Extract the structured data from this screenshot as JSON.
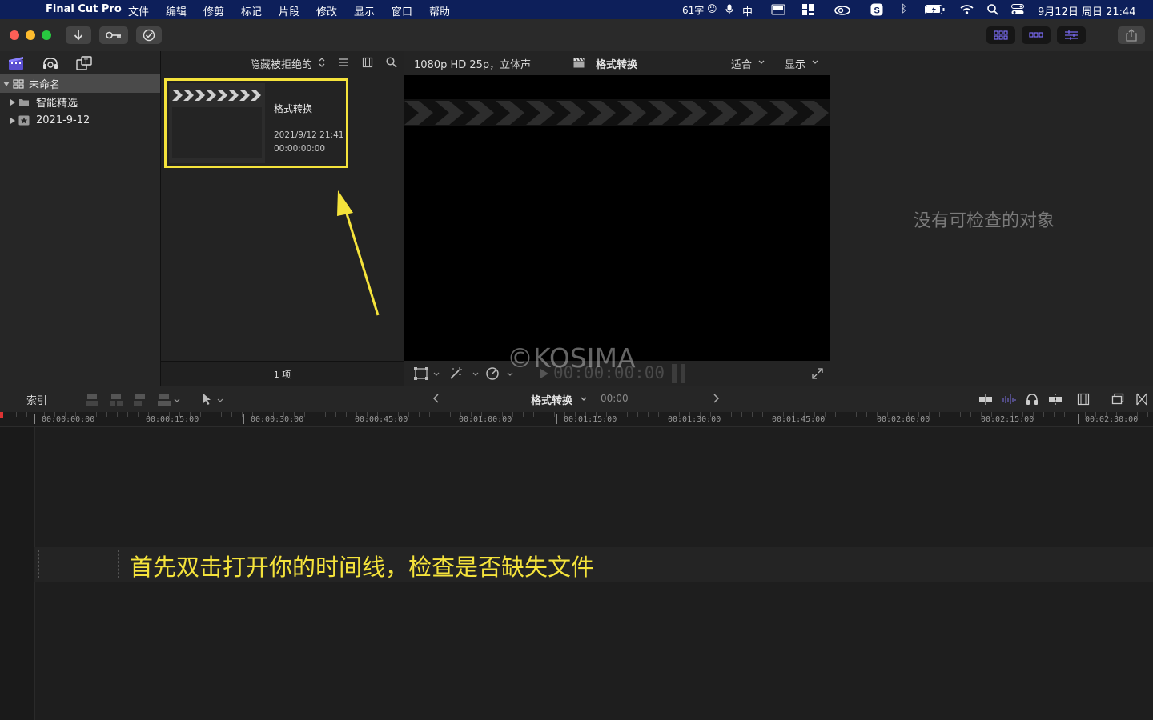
{
  "menubar": {
    "app_name": "Final Cut Pro",
    "menus": [
      "文件",
      "编辑",
      "修剪",
      "标记",
      "片段",
      "修改",
      "显示",
      "窗口",
      "帮助"
    ],
    "char_count": "61字",
    "input_method": "中",
    "datetime": "9月12日 周日  21:44"
  },
  "libraries": {
    "library_name": "未命名",
    "items": [
      "智能精选",
      "2021-9-12"
    ]
  },
  "browser": {
    "filter_label": "隐藏被拒绝的",
    "clip": {
      "name": "格式转换",
      "date": "2021/9/12 21:41",
      "duration": "00:00:00:00"
    },
    "item_count": "1 项"
  },
  "viewer": {
    "format": "1080p HD 25p，立体声",
    "project_name": "格式转换",
    "fit_label": "适合",
    "display_label": "显示",
    "timecode": "00:00:00:00"
  },
  "inspector": {
    "empty_message": "没有可检查的对象"
  },
  "timeline": {
    "index_label": "索引",
    "project_name": "格式转换",
    "duration": "00:00",
    "ruler_labels": [
      "00:00:00:00",
      "00:00:15:00",
      "00:00:30:00",
      "00:00:45:00",
      "00:01:00:00",
      "00:01:15:00",
      "00:01:30:00",
      "00:01:45:00",
      "00:02:00:00",
      "00:02:15:00",
      "00:02:30:00"
    ]
  },
  "overlay": {
    "watermark": "©KOSIMA",
    "caption": "首先双击打开你的时间线，检查是否缺失文件",
    "highlight_color": "#f5e33b",
    "caption_color": "#f5e33b"
  },
  "colors": {
    "menubar_bg": "#0d1f5a",
    "accent_purple": "#7b6cf6",
    "selection_gray": "#4a4a4a"
  }
}
